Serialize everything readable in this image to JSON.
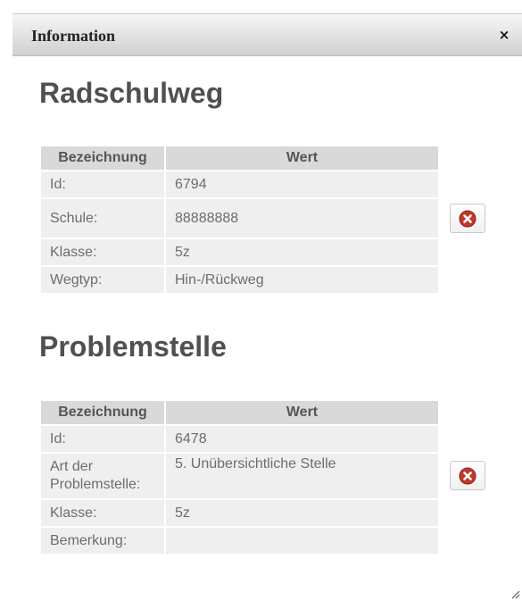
{
  "dialog": {
    "title": "Information",
    "close_symbol": "×"
  },
  "sections": [
    {
      "heading": "Radschulweg",
      "columns": [
        "Bezeichnung",
        "Wert"
      ],
      "rows": [
        {
          "label": "Id:",
          "value": "6794"
        },
        {
          "label": "Schule:",
          "value": "88888888"
        },
        {
          "label": "Klasse:",
          "value": "5z"
        },
        {
          "label": "Wegtyp:",
          "value": "Hin-/Rückweg"
        }
      ],
      "delete_icon": "red-x-circle-icon"
    },
    {
      "heading": "Problemstelle",
      "columns": [
        "Bezeichnung",
        "Wert"
      ],
      "rows": [
        {
          "label": "Id:",
          "value": "6478"
        },
        {
          "label": "Art der Problemstelle:",
          "value": "5. Unübersichtliche Stelle"
        },
        {
          "label": "Klasse:",
          "value": "5z"
        },
        {
          "label": "Bemerkung:",
          "value": ""
        }
      ],
      "delete_icon": "red-x-circle-icon"
    }
  ],
  "colors": {
    "delete_red": "#c0392b",
    "header_bg": "#d9d9d9",
    "cell_bg": "#efefef"
  }
}
